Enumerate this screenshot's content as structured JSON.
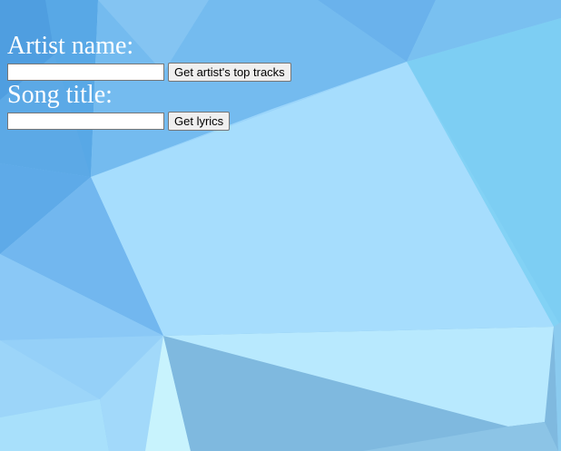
{
  "artist": {
    "label": "Artist name:",
    "input_value": "",
    "button_label": "Get artist's top tracks"
  },
  "song": {
    "label": "Song title:",
    "input_value": "",
    "button_label": "Get lyrics"
  },
  "background": {
    "style": "low-poly triangles",
    "palette": [
      "#4e9fe0",
      "#6cb5ee",
      "#88c9f5",
      "#a6dffd",
      "#7ccdf2",
      "#b7e8fe",
      "#c5f3fd",
      "#80b8e0",
      "#5aa6e6"
    ]
  }
}
